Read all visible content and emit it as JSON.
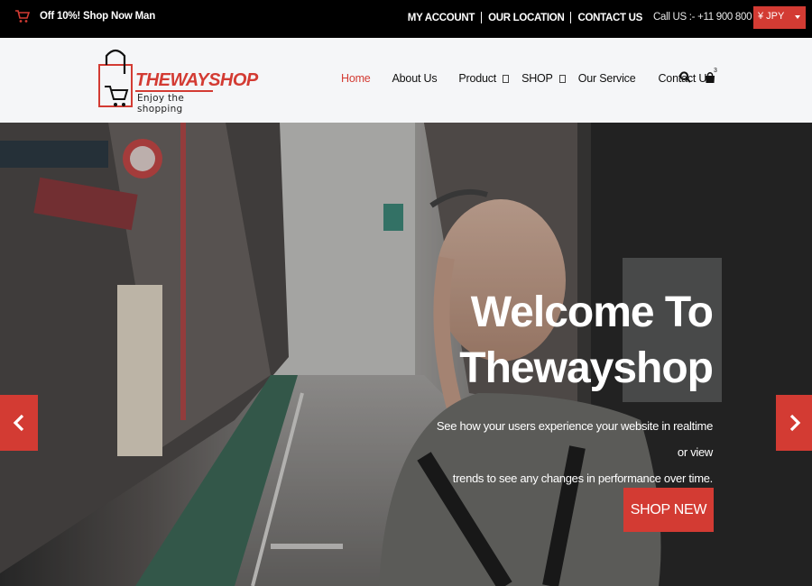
{
  "topbar": {
    "promo": "Off 10%! Shop Now Man",
    "links": [
      "MY ACCOUNT",
      "OUR LOCATION",
      "CONTACT US"
    ],
    "call": "Call US :- +11 900 800 100",
    "currency": "¥ JPY"
  },
  "header": {
    "logo_title": "THEWAYSHOP",
    "logo_sub": "Enjoy the shopping",
    "nav": [
      {
        "label": "Home",
        "active": true
      },
      {
        "label": "About Us"
      },
      {
        "label": "Product"
      },
      {
        "label": "SHOP"
      },
      {
        "label": "Our Service"
      },
      {
        "label": "Contact Us"
      }
    ],
    "cart_count": "3"
  },
  "hero": {
    "title_line1": "Welcome To",
    "title_line2": "Thewayshop",
    "desc_line1": "See how your users experience your website in realtime or view",
    "desc_line2": "trends to see any changes in performance over time.",
    "button": "SHOP NEW"
  },
  "icons": {
    "promo": "cart-icon",
    "search": "search-icon",
    "bag": "bag-icon",
    "prev": "chevron-left-icon",
    "next": "chevron-right-icon"
  },
  "colors": {
    "accent": "#d33b33",
    "topbar_bg": "#000000",
    "header_bg": "#f5f6f8"
  }
}
